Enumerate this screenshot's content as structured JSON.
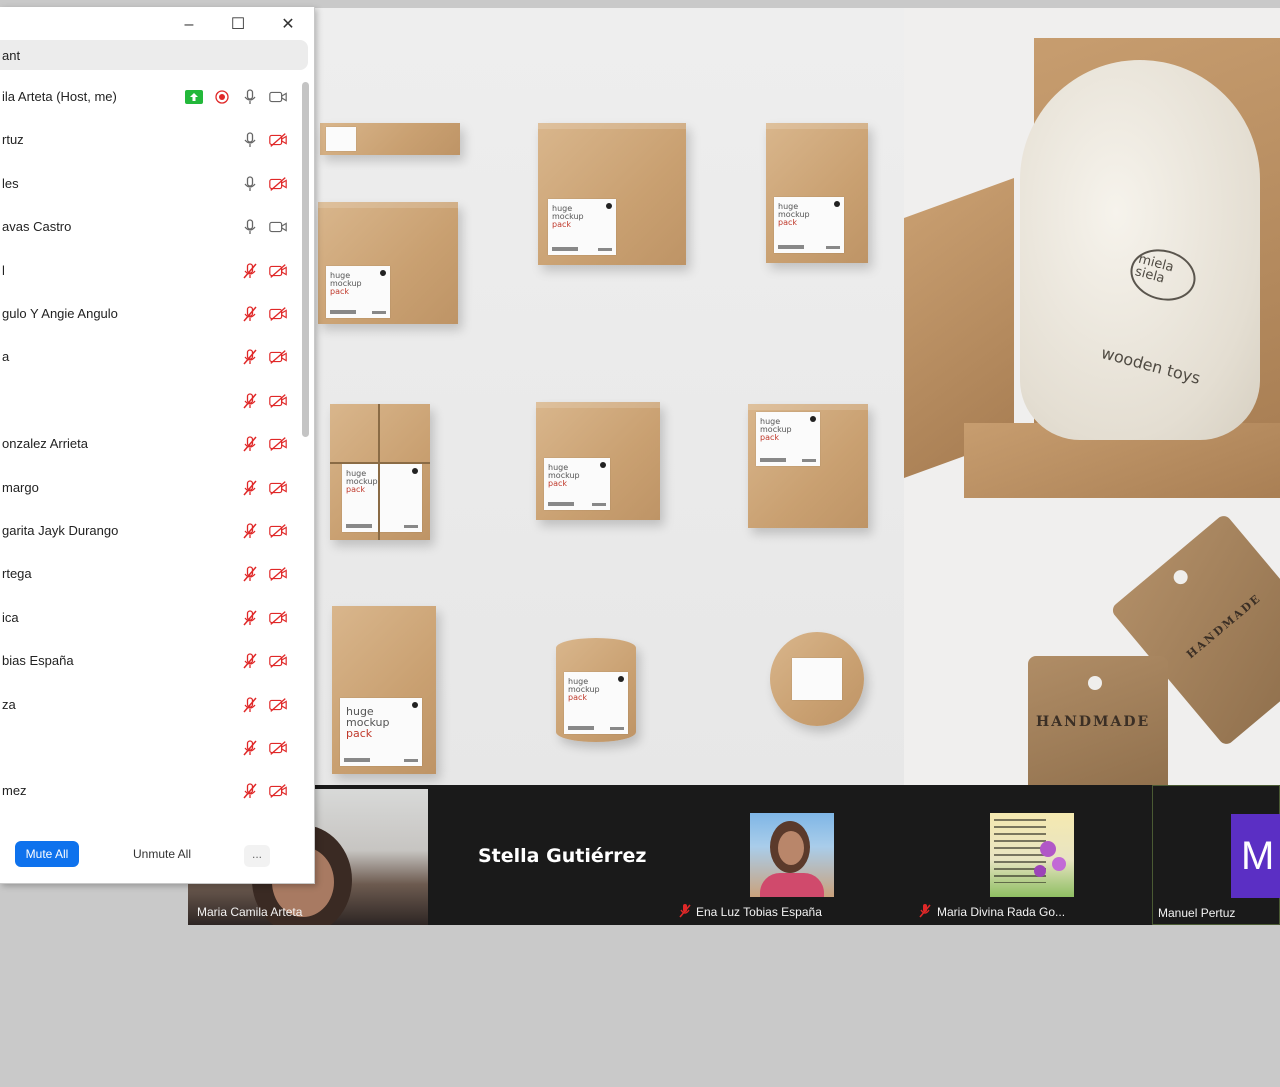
{
  "participants_panel": {
    "title": "ant",
    "window_controls": {
      "minimize": "–",
      "maximize": "☐",
      "close": "✕"
    },
    "participants": [
      {
        "name": "ila Arteta (Host, me)",
        "mic": "on",
        "video": "on",
        "sharing": true,
        "recording": true
      },
      {
        "name": "rtuz",
        "mic": "on",
        "video": "off"
      },
      {
        "name": "les",
        "mic": "on",
        "video": "off"
      },
      {
        "name": "avas Castro",
        "mic": "on",
        "video": "on"
      },
      {
        "name": "l",
        "mic": "muted",
        "video": "off"
      },
      {
        "name": "gulo Y Angie Angulo",
        "mic": "muted",
        "video": "off"
      },
      {
        "name": "a",
        "mic": "muted",
        "video": "off"
      },
      {
        "name": "",
        "mic": "muted",
        "video": "off"
      },
      {
        "name": "onzalez Arrieta",
        "mic": "muted",
        "video": "off"
      },
      {
        "name": "margo",
        "mic": "muted",
        "video": "off"
      },
      {
        "name": "garita Jayk Durango",
        "mic": "muted",
        "video": "off"
      },
      {
        "name": "rtega",
        "mic": "muted",
        "video": "off"
      },
      {
        "name": "ica",
        "mic": "muted",
        "video": "off"
      },
      {
        "name": "bias España",
        "mic": "muted",
        "video": "off"
      },
      {
        "name": "za",
        "mic": "muted",
        "video": "off"
      },
      {
        "name": "",
        "mic": "muted",
        "video": "off"
      },
      {
        "name": "mez",
        "mic": "muted",
        "video": "off"
      }
    ],
    "buttons": {
      "mute_all": "Mute All",
      "unmute_all": "Unmute All",
      "more": "..."
    }
  },
  "shared_screen": {
    "mockup_label": {
      "line1": "huge",
      "line2": "mockup",
      "line3": "pack"
    },
    "bag_logo": "miela siela",
    "bag_text": "wooden toys",
    "tag_text_1": "HANDMADE",
    "tag_text_2": "HANDMADE"
  },
  "video_strip": {
    "tiles": [
      {
        "name": "Maria Camila Arteta",
        "muted": true
      },
      {
        "name": "Stella Gutiérrez",
        "muted": false
      },
      {
        "name": "Ena Luz Tobias España",
        "muted": true
      },
      {
        "name": "Maria Divina Rada Go...",
        "muted": true
      },
      {
        "name": "Manuel Pertuz",
        "muted": false,
        "avatar_letter": "M"
      }
    ]
  },
  "colors": {
    "accent_blue": "#0e72ed",
    "muted_red": "#e02828",
    "sharing_green": "#23b83a",
    "avatar_purple": "#5b2fc4",
    "video_bg": "#1a1a1a"
  }
}
